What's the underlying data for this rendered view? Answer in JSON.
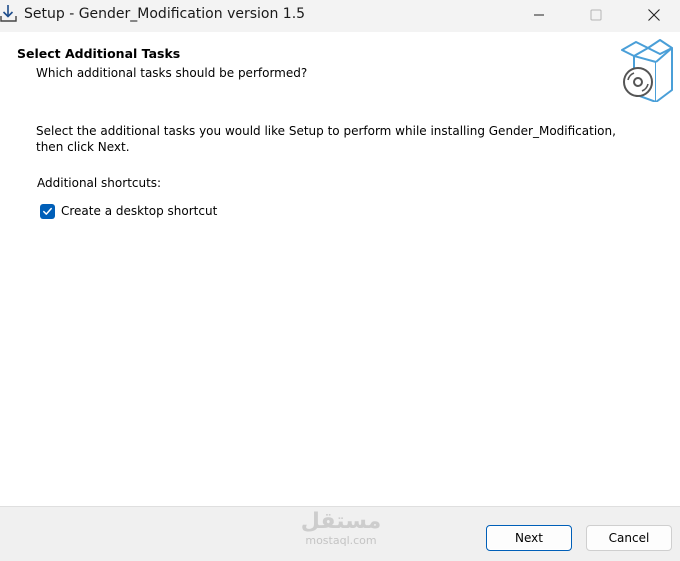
{
  "window": {
    "title": "Setup - Gender_Modification version 1.5",
    "controls": {
      "minimize_icon": "minimize-icon",
      "maximize_icon": "maximize-icon",
      "close_icon": "close-icon"
    }
  },
  "header": {
    "title": "Select Additional Tasks",
    "subtitle": "Which additional tasks should be performed?",
    "image_icon": "installer-box-cd-icon"
  },
  "content": {
    "description": "Select the additional tasks you would like Setup to perform while installing Gender_Modification, then click Next.",
    "group_label": "Additional shortcuts:",
    "tasks": [
      {
        "label": "Create a desktop shortcut",
        "checked": true
      }
    ]
  },
  "footer": {
    "watermark_arabic": "مستقل",
    "watermark_latin": "mostaql.com",
    "next_label": "Next",
    "cancel_label": "Cancel"
  },
  "colors": {
    "accent": "#005fb8",
    "titlebar": "#f3f3f3",
    "footer": "#f0f0f0",
    "icon_blue": "#4a9fd8"
  }
}
